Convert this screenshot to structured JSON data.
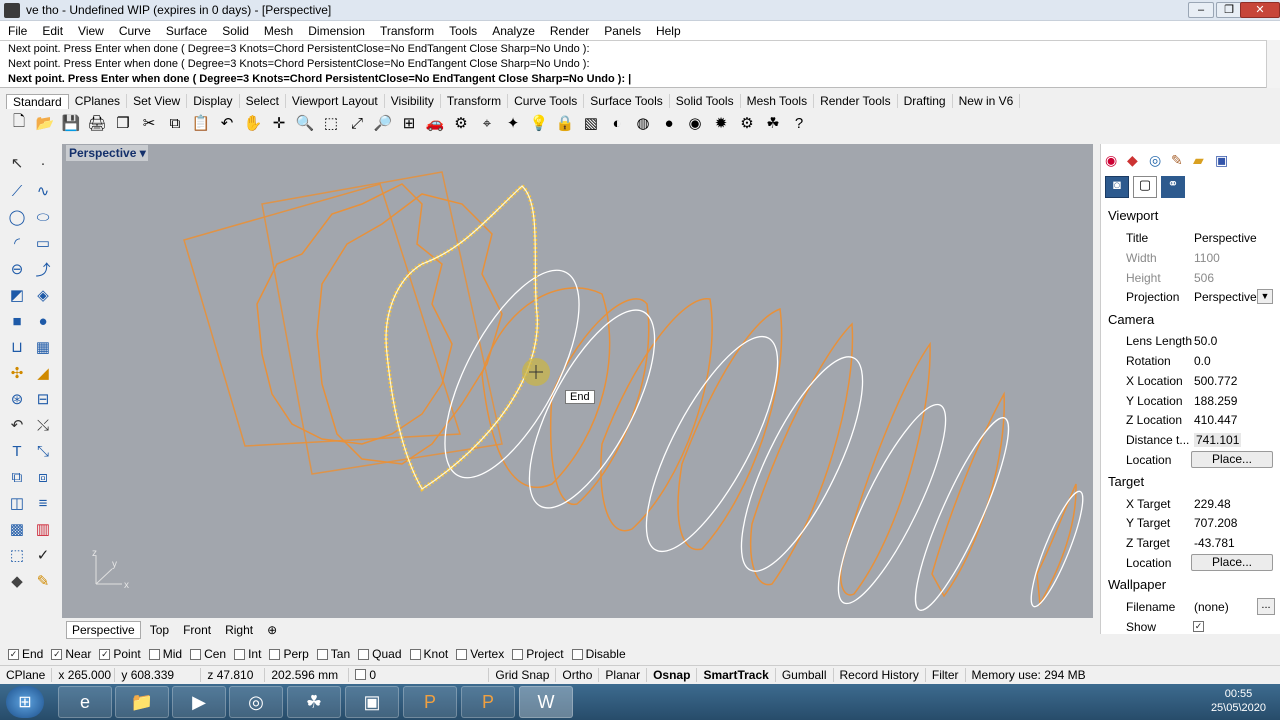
{
  "window": {
    "title": "ve tho - Undefined WIP (expires in 0 days) - [Perspective]",
    "minimize": "–",
    "maximize": "❐",
    "close": "✕"
  },
  "menu": [
    "File",
    "Edit",
    "View",
    "Curve",
    "Surface",
    "Solid",
    "Mesh",
    "Dimension",
    "Transform",
    "Tools",
    "Analyze",
    "Render",
    "Panels",
    "Help"
  ],
  "command": {
    "history": [
      "Next point. Press Enter when done ( Degree=3  Knots=Chord  PersistentClose=No  EndTangent  Close  Sharp=No  Undo ):",
      "Next point. Press Enter when done ( Degree=3  Knots=Chord  PersistentClose=No  EndTangent  Close  Sharp=No  Undo ):"
    ],
    "prompt": "Next point. Press Enter when done ( Degree=3  Knots=Chord  PersistentClose=No  EndTangent  Close  Sharp=No  Undo ): |"
  },
  "toolbar_tabs": [
    "Standard",
    "CPlanes",
    "Set View",
    "Display",
    "Select",
    "Viewport Layout",
    "Visibility",
    "Transform",
    "Curve Tools",
    "Surface Tools",
    "Solid Tools",
    "Mesh Tools",
    "Render Tools",
    "Drafting",
    "New in V6"
  ],
  "toolbar_icons": [
    "new-icon",
    "open-icon",
    "save-icon",
    "print-icon",
    "import-icon",
    "cut-icon",
    "copy-icon",
    "paste-icon",
    "undo-icon",
    "pan-icon",
    "move-icon",
    "zoom-icon",
    "zoom-window-icon",
    "zoom-extents-icon",
    "zoom-selected-icon",
    "four-view-icon",
    "car-icon",
    "options-icon",
    "cplane-icon",
    "snap-icon",
    "bulb-icon",
    "lock-icon",
    "layer-icon",
    "color-wheel-icon",
    "sphere-wire-icon",
    "sphere-shaded-icon",
    "sphere-render-icon",
    "light-icon",
    "settings-icon",
    "grasshopper-icon",
    "help-icon"
  ],
  "toolbar_glyphs": [
    "🗋",
    "📂",
    "💾",
    "🖨",
    "❐",
    "✂",
    "⧉",
    "📋",
    "↶",
    "✋",
    "✛",
    "🔍",
    "⬚",
    "⤢",
    "🔎",
    "⊞",
    "🚗",
    "⚙",
    "⌖",
    "✦",
    "💡",
    "🔒",
    "▧",
    "◐",
    "◍",
    "●",
    "◉",
    "✹",
    "⚙",
    "☘",
    "?"
  ],
  "viewport": {
    "title": "Perspective",
    "snap_label": "End",
    "tabs": [
      "Perspective",
      "Top",
      "Front",
      "Right"
    ],
    "add_tab": "⊕",
    "axis_x": "x",
    "axis_y": "y",
    "axis_z": "z"
  },
  "properties": {
    "viewport_header": "Viewport",
    "title_label": "Title",
    "title_value": "Perspective",
    "width_label": "Width",
    "width_value": "1100",
    "height_label": "Height",
    "height_value": "506",
    "projection_label": "Projection",
    "projection_value": "Perspective",
    "camera_header": "Camera",
    "lens_label": "Lens Length",
    "lens_value": "50.0",
    "rotation_label": "Rotation",
    "rotation_value": "0.0",
    "xloc_label": "X Location",
    "xloc_value": "500.772",
    "yloc_label": "Y Location",
    "yloc_value": "188.259",
    "zloc_label": "Z Location",
    "zloc_value": "410.447",
    "dist_label": "Distance t...",
    "dist_value": "741.101",
    "camloc_label": "Location",
    "place_button": "Place...",
    "target_header": "Target",
    "xtgt_label": "X Target",
    "xtgt_value": "229.48",
    "ytgt_label": "Y Target",
    "ytgt_value": "707.208",
    "ztgt_label": "Z Target",
    "ztgt_value": "-43.781",
    "tgtloc_label": "Location",
    "wallpaper_header": "Wallpaper",
    "filename_label": "Filename",
    "filename_value": "(none)",
    "browse_button": "...",
    "show_label": "Show"
  },
  "osnaps": [
    {
      "label": "End",
      "checked": true
    },
    {
      "label": "Near",
      "checked": true
    },
    {
      "label": "Point",
      "checked": true
    },
    {
      "label": "Mid",
      "checked": false
    },
    {
      "label": "Cen",
      "checked": false
    },
    {
      "label": "Int",
      "checked": false
    },
    {
      "label": "Perp",
      "checked": false
    },
    {
      "label": "Tan",
      "checked": false
    },
    {
      "label": "Quad",
      "checked": false
    },
    {
      "label": "Knot",
      "checked": false
    },
    {
      "label": "Vertex",
      "checked": false
    },
    {
      "label": "Project",
      "checked": false
    },
    {
      "label": "Disable",
      "checked": false
    }
  ],
  "status": {
    "cplane": "CPlane",
    "x": "x 265.000",
    "y": "y 608.339",
    "z": "z 47.810",
    "units": "202.596 mm",
    "layer": "0",
    "grid_snap": "Grid Snap",
    "ortho": "Ortho",
    "planar": "Planar",
    "osnap": "Osnap",
    "smarttrack": "SmartTrack",
    "gumball": "Gumball",
    "record_history": "Record History",
    "filter": "Filter",
    "memory": "Memory use: 294 MB"
  },
  "taskbar": {
    "start": "⊞",
    "apps": [
      "e",
      "📁",
      "▶",
      "◎",
      "☘",
      "▣",
      "P",
      "P",
      "W"
    ],
    "time": "00:55",
    "date": "25\\05\\2020"
  },
  "colors": {
    "curve_orange": "#e8913a",
    "curve_white": "#ffffff",
    "curve_selected": "#f5c13b",
    "viewport_bg": "#a2a6ad"
  }
}
